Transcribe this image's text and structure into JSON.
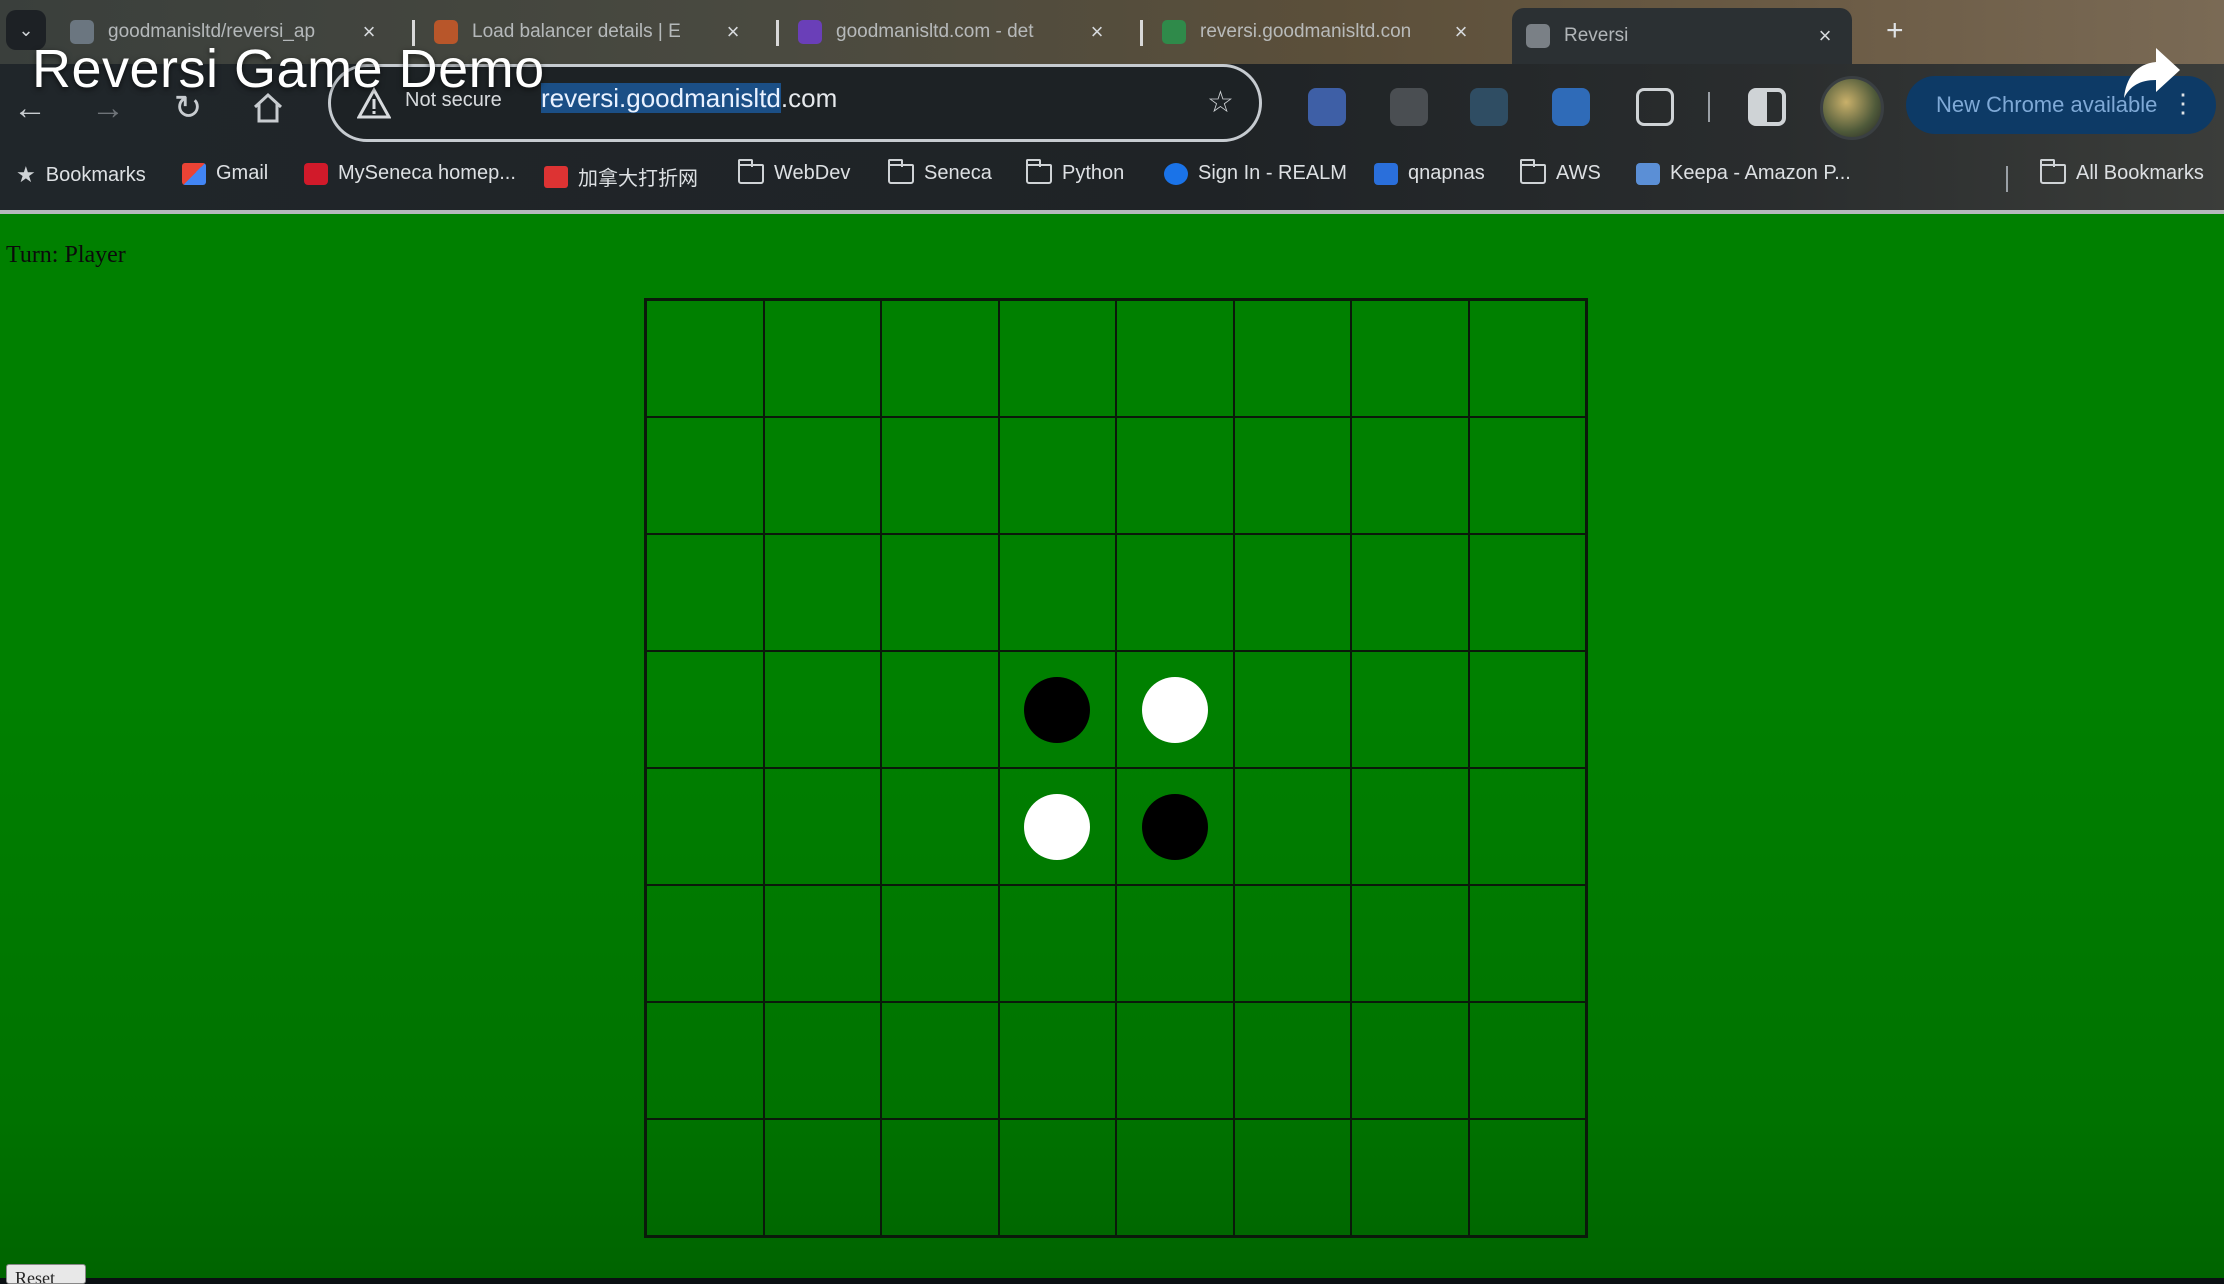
{
  "overlay": {
    "video_title": "Reversi Game Demo"
  },
  "tabs": [
    {
      "label": "goodmanisltd/reversi_ap",
      "fav_color": "#6b7680",
      "active": false
    },
    {
      "label": "Load balancer details | E",
      "fav_color": "#b8562a",
      "active": false
    },
    {
      "label": "goodmanisltd.com - det",
      "fav_color": "#6a3fb8",
      "active": false
    },
    {
      "label": "reversi.goodmanisltd.con",
      "fav_color": "#2f8a4a",
      "active": false
    },
    {
      "label": "Reversi",
      "fav_color": "#7a8086",
      "active": true
    }
  ],
  "tab_close_glyph": "×",
  "new_tab_glyph": "+",
  "omnibox": {
    "security_label": "Not secure",
    "url_selected": "reversi.goodmanisltd",
    "url_rest": ".com"
  },
  "update_button": {
    "label": "New Chrome available"
  },
  "bookmarks": [
    {
      "label": "Bookmarks",
      "icon": "star-icon"
    },
    {
      "label": "Gmail",
      "icon": "gmail-icon"
    },
    {
      "label": "MySeneca homep...",
      "icon": "seneca-icon"
    },
    {
      "label": "加拿大打折网",
      "icon": "site-icon"
    },
    {
      "label": "WebDev",
      "icon": "folder-icon"
    },
    {
      "label": "Seneca",
      "icon": "folder-icon"
    },
    {
      "label": "Python",
      "icon": "folder-icon"
    },
    {
      "label": "Sign In - REALM",
      "icon": "realm-icon"
    },
    {
      "label": "qnapnas",
      "icon": "qnap-icon"
    },
    {
      "label": "AWS",
      "icon": "folder-icon"
    },
    {
      "label": "Keepa - Amazon P...",
      "icon": "keepa-icon"
    }
  ],
  "all_bookmarks_label": "All Bookmarks",
  "game": {
    "turn_text": "Turn: Player",
    "board_size": 8,
    "discs": [
      {
        "row": 3,
        "col": 3,
        "color": "black"
      },
      {
        "row": 3,
        "col": 4,
        "color": "white"
      },
      {
        "row": 4,
        "col": 3,
        "color": "white"
      },
      {
        "row": 4,
        "col": 4,
        "color": "black"
      }
    ],
    "reset_label": "Reset"
  },
  "colors": {
    "board_green": "#008000",
    "grid_line": "#0a1a0a",
    "url_selection": "#1b4f86",
    "update_button_bg": "#0d3a66"
  }
}
